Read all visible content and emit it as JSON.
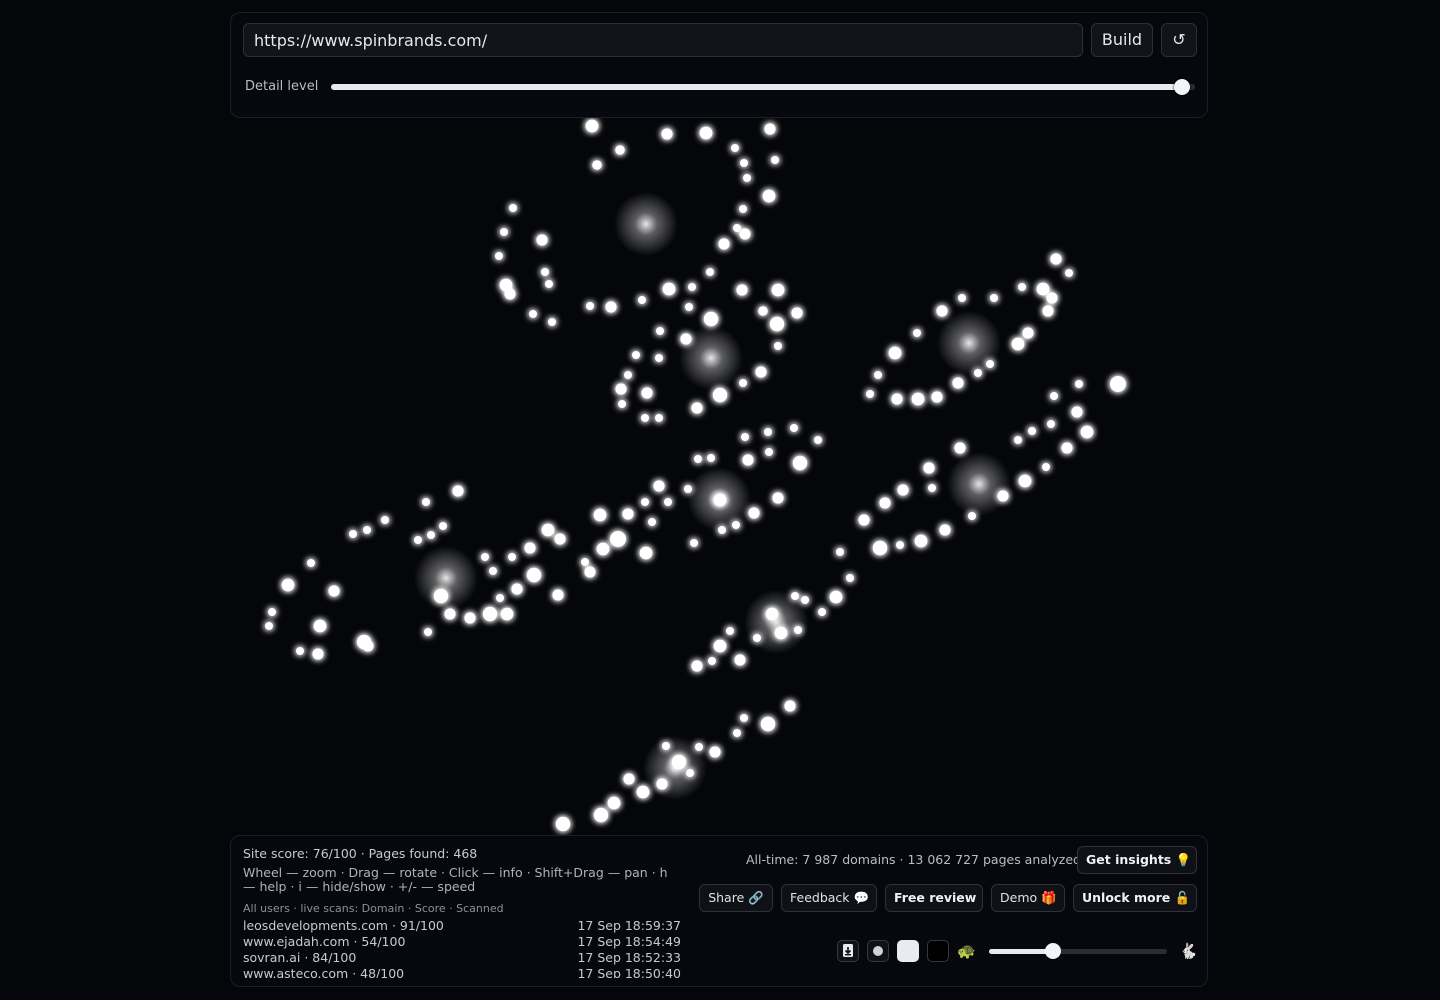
{
  "toolbar": {
    "url_value": "https://www.spinbrands.com/",
    "build_label": "Build",
    "reset_glyph": "↺",
    "detail_label": "Detail level",
    "detail_level": 0.985
  },
  "info": {
    "site_score": "Site score: 76/100 · Pages found: 468",
    "help": "Wheel — zoom · Drag — rotate · Click — info · Shift+Drag — pan · h — help · i — hide/show · +/- — speed",
    "scans_header": "All users · live scans: Domain · Score · Scanned",
    "scans": [
      {
        "domain": "leosdevelopments.com · 91/100",
        "time": "17 Sep 18:59:37"
      },
      {
        "domain": "www.ejadah.com · 54/100",
        "time": "17 Sep 18:54:49"
      },
      {
        "domain": "sovran.ai · 84/100",
        "time": "17 Sep 18:52:33"
      },
      {
        "domain": "www.asteco.com · 48/100",
        "time": "17 Sep 18:50:40"
      }
    ],
    "alltime": "All-time: 7 987 domains · 13 062 727 pages analyzed"
  },
  "actions": {
    "insights_label": "Get insights 💡",
    "share_label": "Share 🔗",
    "feedback_label": "Feedback 💬",
    "review_label": "Free review",
    "demo_label": "Demo 🎁",
    "unlock_label": "Unlock more 🔓"
  },
  "controls": {
    "download_icon": "download-icon",
    "slow_glyph": "🐢",
    "fast_glyph": "🐇",
    "speed_level": 0.36
  },
  "colors": {
    "background": "#05060a",
    "node": "#ffffff",
    "panel_border": "#1b1e27"
  }
}
